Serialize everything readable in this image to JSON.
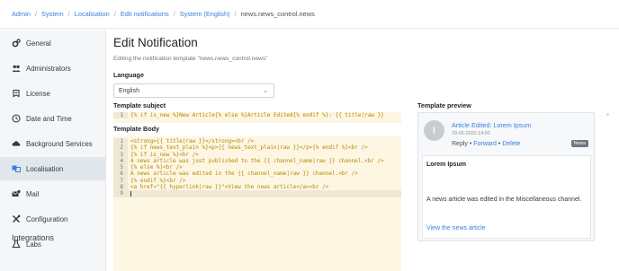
{
  "breadcrumb": {
    "items": [
      "Admin",
      "System",
      "Localisation",
      "Edit notifications",
      "System (English)"
    ],
    "current": "news.news_control.news"
  },
  "sidebar": {
    "items": [
      {
        "label": "General",
        "icon": "cogs-icon"
      },
      {
        "label": "Administrators",
        "icon": "users-icon"
      },
      {
        "label": "License",
        "icon": "license-icon"
      },
      {
        "label": "Date and Time",
        "icon": "clock-icon"
      },
      {
        "label": "Background Services",
        "icon": "cloud-icon"
      },
      {
        "label": "Localisation",
        "icon": "language-icon",
        "active": true
      },
      {
        "label": "Mail",
        "icon": "mail-icon"
      },
      {
        "label": "Configuration",
        "icon": "tools-icon"
      },
      {
        "label": "Labs",
        "icon": "flask-icon"
      }
    ],
    "section": "Integrations"
  },
  "main": {
    "title": "Edit Notification",
    "subtitle": "Editing the notification template \"news.news_control.news\"",
    "language_label": "Language",
    "language_value": "English",
    "subject_label": "Template subject",
    "subject_lines": [
      "{% if is_new %}New Article{% else %}Article Edited{% endif %}: {{ title|raw }}"
    ],
    "body_label": "Template Body",
    "body_lines": [
      "<strong>{{ title|raw }}</strong><br />",
      "{% if news_text_plain %}<p>{{ news_text_plain|raw }}</p>{% endif %}<br />",
      "{% if is_new %}<br />",
      "A news article was just published to the {{ channel_name|raw }} channel.<br />",
      "{% else %}<br />",
      "A news article was edited in the {{ channel_name|raw }} channel.<br />",
      "{% endif %}<br />",
      "<a href=\"{{ hyperlink|raw }}\">View the news article</a><br />",
      ""
    ]
  },
  "preview": {
    "title": "Template preview",
    "headline": "Article Edited: Lorem Ipsum",
    "date": "29-05-2020 14:00",
    "reply": "Reply",
    "forward": "Forward",
    "delete": "Delete",
    "bullet": "•",
    "badge": "News",
    "avatar": "!",
    "body_title": "Lorem Ipsum",
    "body_text": "A news article was edited in the Miscellaneous channel.",
    "link": "View the news article"
  },
  "colors": {
    "link": "#3b7ddd",
    "code_bg": "#fdf6e3",
    "code_text": "#b58900",
    "sidebar_bg": "#f5f6f8"
  }
}
